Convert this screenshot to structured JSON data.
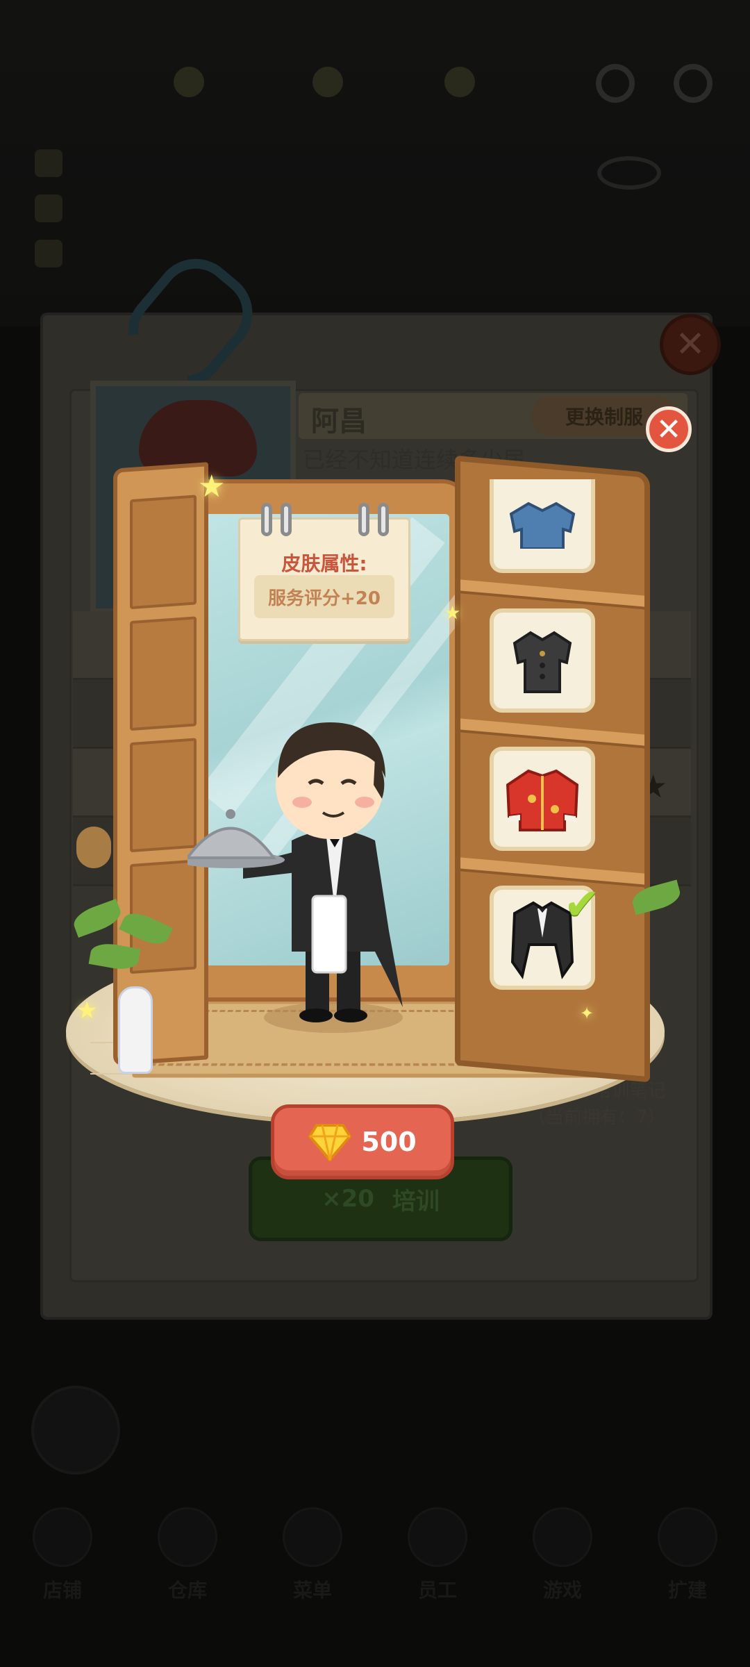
{
  "character": {
    "name": "阿昌",
    "description_line1": "已经不知道连续多少届"
  },
  "header_buttons": {
    "change_uniform": "更换制服"
  },
  "wardrobe": {
    "skin_attr_title": "皮肤属性:",
    "skin_attr_value": "服务评分+20",
    "items": [
      {
        "name": "blue-shirt-outfit",
        "selected": false
      },
      {
        "name": "black-shirt-outfit",
        "selected": false
      },
      {
        "name": "red-tang-jacket-outfit",
        "selected": false
      },
      {
        "name": "tailcoat-outfit",
        "selected": true
      }
    ],
    "price": "500",
    "currency_icon": "diamond-icon"
  },
  "background": {
    "train_count": "×20",
    "train_label": "培训",
    "notes_label": "培训笔记",
    "owned_count": "（当前拥有：7）",
    "nav": [
      "店铺",
      "仓库",
      "菜单",
      "员工",
      "游戏",
      "扩建"
    ]
  },
  "colors": {
    "price_button": "#e36552",
    "close_button": "#e4553f",
    "skin_title": "#c9553c",
    "check_mark": "#a6d83a"
  }
}
